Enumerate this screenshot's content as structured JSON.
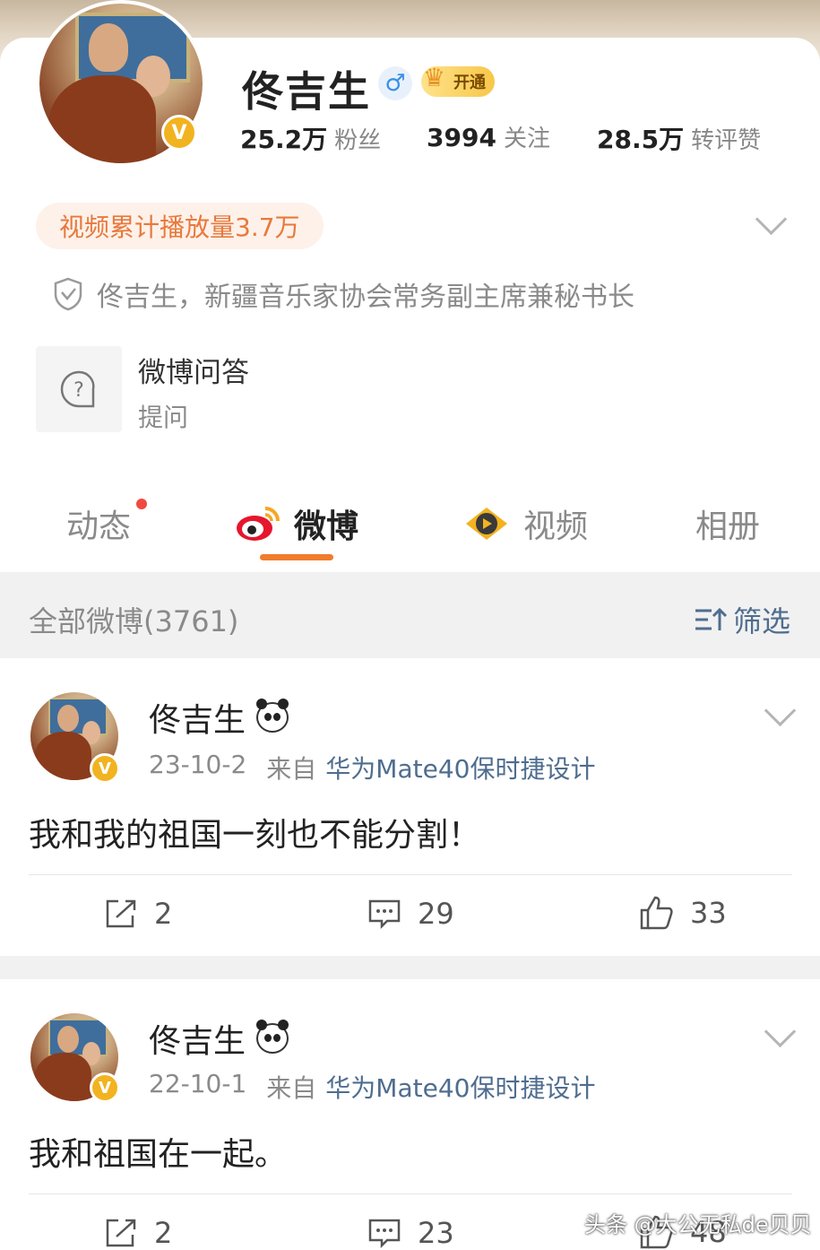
{
  "profile": {
    "name": "佟吉生",
    "gender_symbol": "♂",
    "vip_label": "开通",
    "stats": [
      {
        "value": "25.2万",
        "label": "粉丝"
      },
      {
        "value": "3994",
        "label": "关注"
      },
      {
        "value": "28.5万",
        "label": "转评赞"
      }
    ],
    "video_plays": "视频累计播放量3.7万",
    "verification": "佟吉生，新疆音乐家协会常务副主席兼秘书长",
    "qa": {
      "title": "微博问答",
      "subtitle": "提问"
    },
    "verified_badge": "V"
  },
  "tabs": [
    {
      "label": "动态",
      "has_dot": true
    },
    {
      "label": "微博",
      "active": true
    },
    {
      "label": "视频"
    },
    {
      "label": "相册"
    }
  ],
  "filter": {
    "all_label": "全部微博(3761)",
    "filter_label": "筛选"
  },
  "posts": [
    {
      "author": "佟吉生",
      "date": "23-10-2",
      "from_label": "来自",
      "source": "华为Mate40保时捷设计",
      "text": "我和我的祖国一刻也不能分割！",
      "reposts": "2",
      "comments": "29",
      "likes": "33"
    },
    {
      "author": "佟吉生",
      "date": "22-10-1",
      "from_label": "来自",
      "source": "华为Mate40保时捷设计",
      "text": "我和祖国在一起。",
      "reposts": "2",
      "comments": "23",
      "likes": "48"
    }
  ],
  "watermark": "头条 @大公无私de贝贝",
  "colors": {
    "accent_orange": "#f07c2c",
    "link_blue": "#4f6d8f",
    "verified_gold": "#f2b320"
  }
}
